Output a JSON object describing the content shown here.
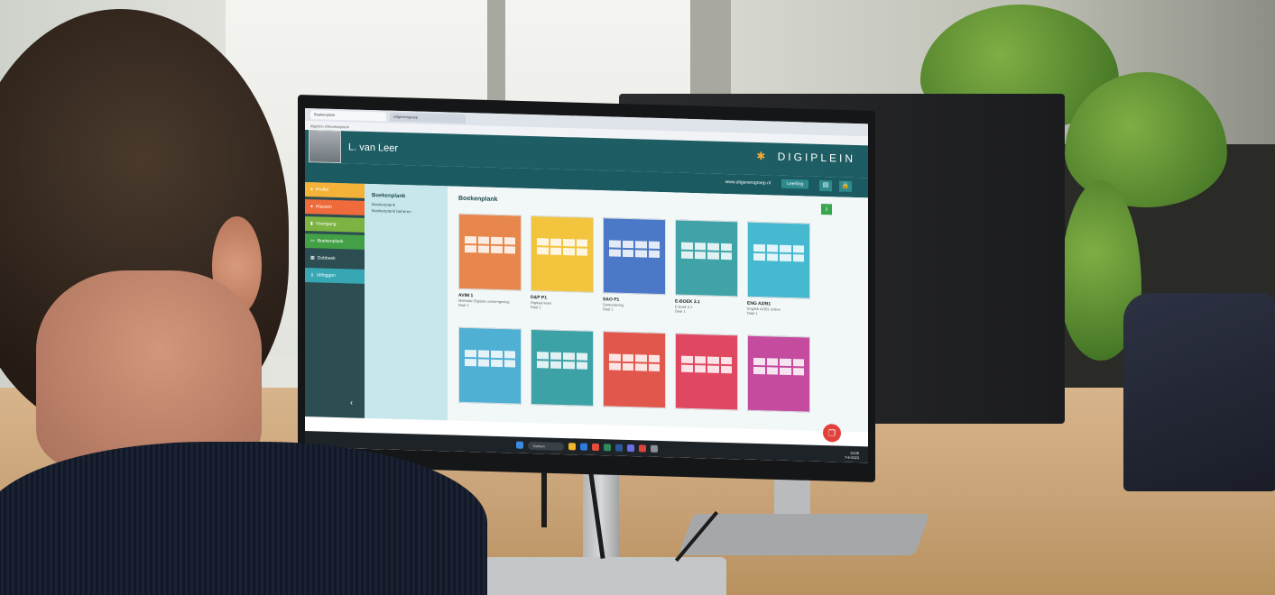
{
  "browser": {
    "tabs": [
      {
        "label": "Boekenplank"
      },
      {
        "label": "Uitgeversgroep"
      }
    ],
    "url": "digiplein.nl/boekenplank"
  },
  "app": {
    "user_name": "L. van Leer",
    "brand": "DIGIPLEIN",
    "publisher_link": "www.uitgeversgroep.nl",
    "role_label": "Leerling"
  },
  "sidebar": {
    "items": [
      {
        "label": "Profiel",
        "color": "#f4b338"
      },
      {
        "label": "Klassen",
        "color": "#ef6b3b"
      },
      {
        "label": "Voortgang",
        "color": "#7cb342"
      },
      {
        "label": "Boekenplank",
        "color": "#43a047"
      },
      {
        "label": "Dobbeek",
        "color": "#2c4d52"
      },
      {
        "label": "Uitloggen",
        "color": "#37a7b3"
      }
    ]
  },
  "subnav": {
    "title": "Boekenplank",
    "items": [
      {
        "label": "Boekenplank"
      },
      {
        "label": "Boekenplank beheren"
      }
    ]
  },
  "content": {
    "title": "Boekenplank",
    "books": [
      {
        "title": "AVIM 1",
        "subtitle": "Methode Digitale Leeromgeving",
        "extra": "Deel 1",
        "color": "#e8874b"
      },
      {
        "title": "D&P P1",
        "subtitle": "Digitaal leren",
        "extra": "Deel 1",
        "color": "#f3c43d"
      },
      {
        "title": "S&O P1",
        "subtitle": "Samenleving",
        "extra": "Deel 1",
        "color": "#4b79c8"
      },
      {
        "title": "E-BOEK 3.1",
        "subtitle": "E-boek 3.1",
        "extra": "Deel 1",
        "color": "#3fa3a8"
      },
      {
        "title": "ENG A2/B1",
        "subtitle": "English A2/B1 online",
        "extra": "Deel 1",
        "color": "#46b8cf"
      },
      {
        "title": "",
        "subtitle": "",
        "extra": "",
        "color": "#4fb0d4"
      },
      {
        "title": "",
        "subtitle": "",
        "extra": "",
        "color": "#3ca2a6"
      },
      {
        "title": "",
        "subtitle": "",
        "extra": "",
        "color": "#e2574c"
      },
      {
        "title": "",
        "subtitle": "",
        "extra": "",
        "color": "#e04862"
      },
      {
        "title": "",
        "subtitle": "",
        "extra": "",
        "color": "#c44b9e"
      }
    ]
  },
  "taskbar": {
    "search_label": "Zoeken",
    "time": "13:05",
    "date": "7-6-2023"
  }
}
